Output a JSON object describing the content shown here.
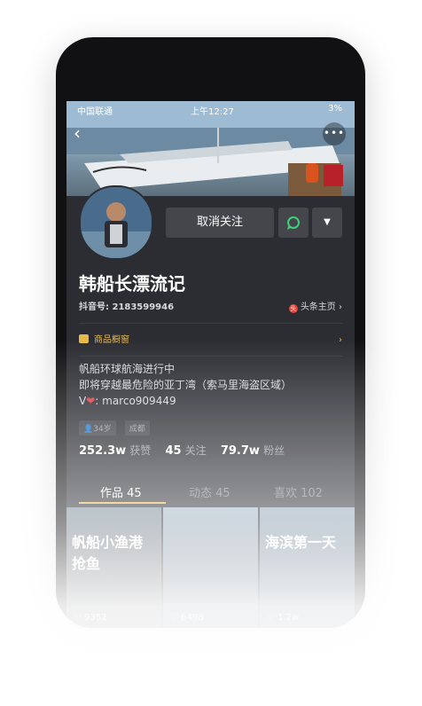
{
  "status_bar": {
    "carrier": "中国联通",
    "time": "上午12:27",
    "right": "3%"
  },
  "actions": {
    "unfollow": "取消关注",
    "dropdown_icon": "triangle-down-icon"
  },
  "profile": {
    "name": "韩船长漂流记",
    "douyin_id": "抖音号: 2183599946",
    "toutiao_link": "头条主页",
    "toutiao_icon_text": "头"
  },
  "shop": {
    "label": "商品橱窗"
  },
  "bio": {
    "line1": "帆船环球航海进行中",
    "line2": "即将穿越最危险的亚丁湾（索马里海盗区域）",
    "line3_prefix": "V",
    "line3_suffix": ": marco909449"
  },
  "tags": [
    "34岁",
    "成都"
  ],
  "stats": {
    "likes_value": "252.3w",
    "likes_label": "获赞",
    "following_value": "45",
    "following_label": "关注",
    "fans_value": "79.7w",
    "fans_label": "粉丝"
  },
  "tabs": {
    "works": "作品 45",
    "dynamic": "动态 45",
    "liked": "喜欢 102"
  },
  "videos": [
    {
      "caption": "帆船小渔港\n抢鱼",
      "likes": "9352"
    },
    {
      "caption": "",
      "likes": "6498"
    },
    {
      "caption": "海滨第一天",
      "likes": "1.2w"
    }
  ],
  "colors": {
    "accent": "#e6b94a",
    "background": "#2c2d33",
    "button": "#45464c"
  }
}
